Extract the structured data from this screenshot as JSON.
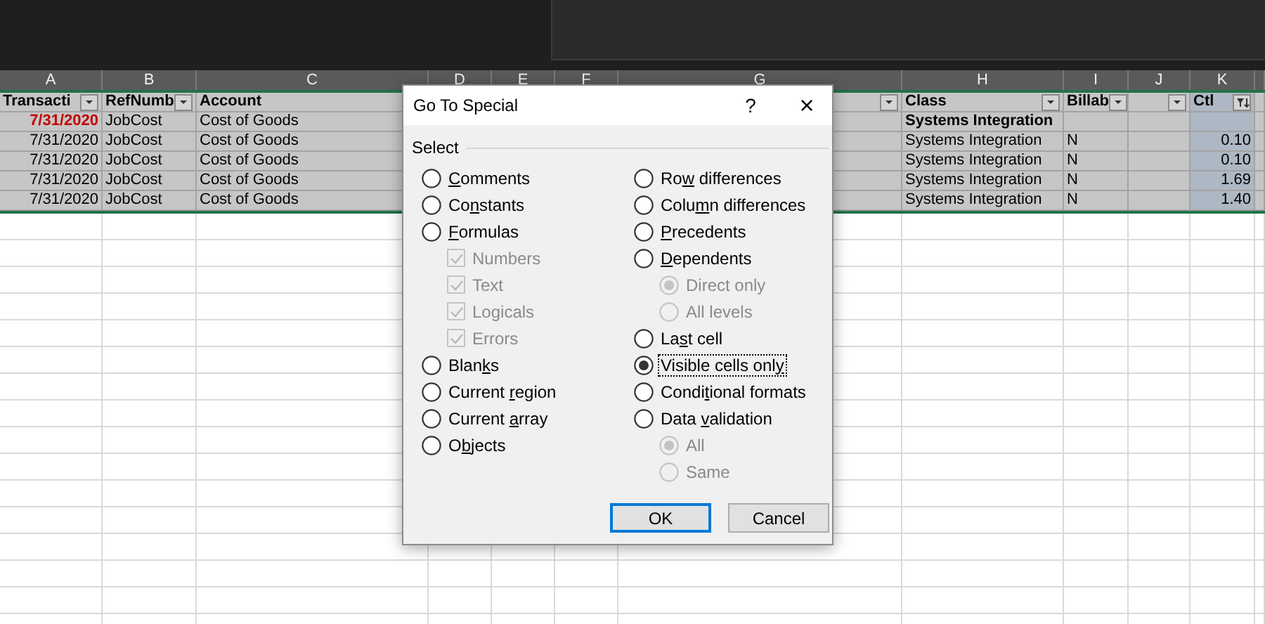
{
  "sheet": {
    "columns": [
      {
        "letter": "A",
        "heading": "Transacti",
        "kind": "filter",
        "highlighted": false
      },
      {
        "letter": "B",
        "heading": "RefNumb",
        "kind": "filter",
        "highlighted": false
      },
      {
        "letter": "C",
        "heading": "Account",
        "kind": "plain",
        "highlighted": false
      },
      {
        "letter": "D",
        "kind": "plain"
      },
      {
        "letter": "E",
        "kind": "plain"
      },
      {
        "letter": "F",
        "kind": "plain"
      },
      {
        "letter": "G",
        "kind": "filter",
        "highlighted": false
      },
      {
        "letter": "H",
        "heading": "Class",
        "kind": "filter",
        "highlighted": false
      },
      {
        "letter": "I",
        "heading": "Billab",
        "kind": "filter",
        "highlighted": false
      },
      {
        "letter": "J",
        "kind": "filter",
        "highlighted": false
      },
      {
        "letter": "K",
        "heading": "Ctl",
        "kind": "filtered",
        "highlighted": true
      }
    ],
    "rows": [
      {
        "kind": "subtotal",
        "cells": [
          "7/31/2020",
          "JobCost",
          "Cost of Goods",
          null,
          null,
          null,
          null,
          "Systems Integration",
          null,
          null,
          null
        ]
      },
      {
        "kind": "detail",
        "cells": [
          "7/31/2020",
          "JobCost",
          "Cost of Goods",
          null,
          null,
          null,
          null,
          "Systems Integration",
          "N",
          null,
          "0.10"
        ]
      },
      {
        "kind": "detail",
        "cells": [
          "7/31/2020",
          "JobCost",
          "Cost of Goods",
          null,
          null,
          null,
          null,
          "Systems Integration",
          "N",
          null,
          "0.10"
        ]
      },
      {
        "kind": "detail",
        "cells": [
          "7/31/2020",
          "JobCost",
          "Cost of Goods",
          null,
          null,
          null,
          null,
          "Systems Integration",
          "N",
          null,
          "1.69"
        ]
      },
      {
        "kind": "detail",
        "cells": [
          "7/31/2020",
          "JobCost",
          "Cost of Goods",
          null,
          null,
          null,
          null,
          "Systems Integration",
          "N",
          null,
          "1.40"
        ]
      }
    ]
  },
  "dialog": {
    "title": "Go To Special",
    "help": "?",
    "close": "×",
    "group_label": "Select",
    "options_left": [
      {
        "kind": "radio",
        "label": [
          {
            "text": "C",
            "underlined": true
          },
          {
            "text": "omments",
            "underlined": false
          }
        ],
        "selected": false,
        "disabled": false,
        "focused": false
      },
      {
        "kind": "radio",
        "label": [
          {
            "text": "Co",
            "underlined": false
          },
          {
            "text": "n",
            "underlined": true
          },
          {
            "text": "stants",
            "underlined": false
          }
        ],
        "selected": false,
        "disabled": false,
        "focused": false
      },
      {
        "kind": "radio",
        "label": [
          {
            "text": "F",
            "underlined": true
          },
          {
            "text": "ormulas",
            "underlined": false
          }
        ],
        "selected": false,
        "disabled": false,
        "focused": false,
        "children": [
          {
            "kind": "checkbox",
            "label": [
              {
                "text": "Numbers",
                "underlined": false
              }
            ],
            "checked": true,
            "disabled": true,
            "focused": false
          },
          {
            "kind": "checkbox",
            "label": [
              {
                "text": "Text",
                "underlined": false
              }
            ],
            "checked": true,
            "disabled": true,
            "focused": false
          },
          {
            "kind": "checkbox",
            "label": [
              {
                "text": "Logicals",
                "underlined": false
              }
            ],
            "checked": true,
            "disabled": true,
            "focused": false
          },
          {
            "kind": "checkbox",
            "label": [
              {
                "text": "Errors",
                "underlined": false
              }
            ],
            "checked": true,
            "disabled": true,
            "focused": false
          }
        ]
      },
      {
        "kind": "radio",
        "label": [
          {
            "text": "Blan",
            "underlined": false
          },
          {
            "text": "k",
            "underlined": true
          },
          {
            "text": "s",
            "underlined": false
          }
        ],
        "selected": false,
        "disabled": false,
        "focused": false
      },
      {
        "kind": "radio",
        "label": [
          {
            "text": "Current ",
            "underlined": false
          },
          {
            "text": "r",
            "underlined": true
          },
          {
            "text": "egion",
            "underlined": false
          }
        ],
        "selected": false,
        "disabled": false,
        "focused": false
      },
      {
        "kind": "radio",
        "label": [
          {
            "text": "Current ",
            "underlined": false
          },
          {
            "text": "a",
            "underlined": true
          },
          {
            "text": "rray",
            "underlined": false
          }
        ],
        "selected": false,
        "disabled": false,
        "focused": false
      },
      {
        "kind": "radio",
        "label": [
          {
            "text": "O",
            "underlined": false
          },
          {
            "text": "b",
            "underlined": true
          },
          {
            "text": "jects",
            "underlined": false
          }
        ],
        "selected": false,
        "disabled": false,
        "focused": false
      }
    ],
    "options_right": [
      {
        "kind": "radio",
        "label": [
          {
            "text": "Ro",
            "underlined": false
          },
          {
            "text": "w",
            "underlined": true
          },
          {
            "text": " differences",
            "underlined": false
          }
        ],
        "selected": false,
        "disabled": false,
        "focused": false
      },
      {
        "kind": "radio",
        "label": [
          {
            "text": "Colu",
            "underlined": false
          },
          {
            "text": "m",
            "underlined": true
          },
          {
            "text": "n differences",
            "underlined": false
          }
        ],
        "selected": false,
        "disabled": false,
        "focused": false
      },
      {
        "kind": "radio",
        "label": [
          {
            "text": "P",
            "underlined": true
          },
          {
            "text": "recedents",
            "underlined": false
          }
        ],
        "selected": false,
        "disabled": false,
        "focused": false
      },
      {
        "kind": "radio",
        "label": [
          {
            "text": "D",
            "underlined": true
          },
          {
            "text": "ependents",
            "underlined": false
          }
        ],
        "selected": false,
        "disabled": false,
        "focused": false,
        "children": [
          {
            "kind": "radio",
            "label": [
              {
                "text": "Direct only",
                "underlined": false
              }
            ],
            "selected": true,
            "disabled": true,
            "focused": false
          },
          {
            "kind": "radio",
            "label": [
              {
                "text": "All levels",
                "underlined": false
              }
            ],
            "selected": false,
            "disabled": true,
            "focused": false
          }
        ]
      },
      {
        "kind": "radio",
        "label": [
          {
            "text": "La",
            "underlined": false
          },
          {
            "text": "s",
            "underlined": true
          },
          {
            "text": "t cell",
            "underlined": false
          }
        ],
        "selected": false,
        "disabled": false,
        "focused": false
      },
      {
        "kind": "radio",
        "label": [
          {
            "text": "Visible cells onl",
            "underlined": false
          },
          {
            "text": "y",
            "underlined": true
          }
        ],
        "selected": true,
        "disabled": false,
        "focused": true
      },
      {
        "kind": "radio",
        "label": [
          {
            "text": "Condi",
            "underlined": false
          },
          {
            "text": "t",
            "underlined": true
          },
          {
            "text": "ional formats",
            "underlined": false
          }
        ],
        "selected": false,
        "disabled": false,
        "focused": false
      },
      {
        "kind": "radio",
        "label": [
          {
            "text": "Data ",
            "underlined": false
          },
          {
            "text": "v",
            "underlined": true
          },
          {
            "text": "alidation",
            "underlined": false
          }
        ],
        "selected": false,
        "disabled": false,
        "focused": false,
        "children": [
          {
            "kind": "radio",
            "label": [
              {
                "text": "All",
                "underlined": false
              }
            ],
            "selected": true,
            "disabled": true,
            "focused": false
          },
          {
            "kind": "radio",
            "label": [
              {
                "text": "Same",
                "underlined": false
              }
            ],
            "selected": false,
            "disabled": true,
            "focused": false
          }
        ]
      }
    ],
    "buttons": [
      {
        "label": "OK",
        "default": true
      },
      {
        "label": "Cancel",
        "default": false
      }
    ]
  }
}
